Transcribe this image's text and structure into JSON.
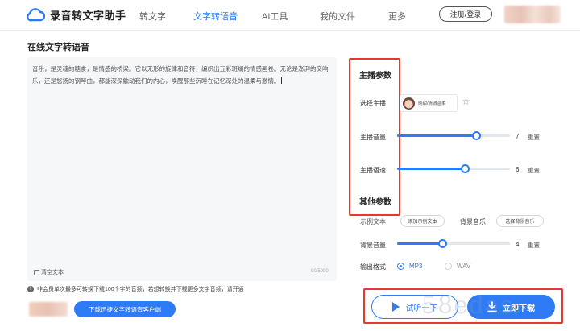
{
  "header": {
    "app_title": "录音转文字助手",
    "nav": [
      {
        "label": "转文字",
        "active": false
      },
      {
        "label": "文字转语音",
        "active": true
      },
      {
        "label": "AI工具",
        "active": false
      },
      {
        "label": "我的文件",
        "active": false
      },
      {
        "label": "更多",
        "active": false
      }
    ],
    "login_label": "注册/登录"
  },
  "page": {
    "title": "在线文字转语音"
  },
  "editor": {
    "text": "音乐，是灵魂的糖食，是情感的桥梁。它以无形的旋律和音符，编织出五彩斑斓的情感画卷。无论是澎湃的交响乐，还是悠扬的钢琴曲，都能深深触动我们的内心，唤醒那些沉睡在记忆深处的温柔与激情。",
    "clear_label": "清空文本",
    "char_count": "90/5000"
  },
  "notice": {
    "text": "非会员单次最多可转换下载100个字的音频，若想转换并下载更多文字音频，请开通",
    "client_button": "下载迅捷文字转语音客户端"
  },
  "panel": {
    "anchor_section_title": "主播参数",
    "anchor_label": "选择主播",
    "anchor_name": "晓甜/清澈温柔",
    "volume": {
      "label": "主播音量",
      "value": "7",
      "fraction": 0.7,
      "reset": "重置"
    },
    "speed": {
      "label": "主播语速",
      "value": "6",
      "fraction": 0.6,
      "reset": "重置"
    },
    "other_section_title": "其他参数",
    "sample_label": "示例文本",
    "sample_button": "添加示例文本",
    "bgm_label": "背景音乐",
    "bgm_button": "选择背景音乐",
    "bgm_volume": {
      "label": "背景音量",
      "value": "4",
      "fraction": 0.4,
      "reset": "重置"
    },
    "format_label": "输出格式",
    "formats": [
      {
        "label": "MP3",
        "checked": true
      },
      {
        "label": "WAV",
        "checked": false
      }
    ]
  },
  "actions": {
    "try_label": "试听一下",
    "download_label": "立即下载"
  },
  "watermark": "58edas",
  "colors": {
    "accent": "#2f7bf5",
    "highlight_border": "#e5392f"
  }
}
